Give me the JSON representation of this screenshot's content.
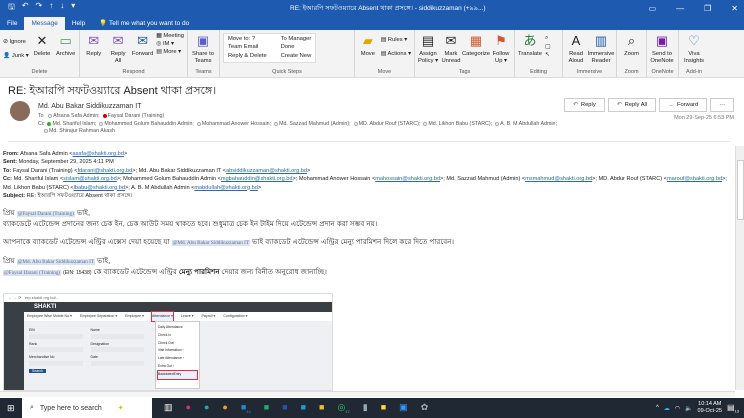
{
  "window": {
    "title": "RE: ইআরপি সফটওয়্যারে Absent থাকা প্রসঙ্গে। - siddikuzzaman (+৯৯...)",
    "qa_icons": [
      "save-icon",
      "undo-icon",
      "redo-icon",
      "up-icon",
      "down-icon",
      "customize-icon"
    ]
  },
  "tabs": [
    "File",
    "Message",
    "Help",
    "Tell me what you want to do"
  ],
  "ribbon": {
    "delete": {
      "label": "Delete",
      "ignore": "Ignore",
      "junk": "Junk ▾",
      "delete": "Delete",
      "archive": "Archive"
    },
    "respond": {
      "label": "Respond",
      "reply": "Reply",
      "reply_all": "Reply All",
      "forward": "Forward",
      "meeting": "Meeting",
      "im": "IM ▾",
      "more": "More ▾"
    },
    "teams": {
      "label": "Teams",
      "share": "Share to Teams"
    },
    "quick_steps": {
      "label": "Quick Steps",
      "items": [
        "Move to: ?",
        "To Manager",
        "Team Email",
        "Done",
        "Reply & Delete",
        "Create New"
      ]
    },
    "move": {
      "label": "Move",
      "move": "Move",
      "rules": "Rules ▾",
      "actions": "Actions ▾"
    },
    "tags": {
      "label": "Tags",
      "assign": "Assign Policy ▾",
      "unread": "Mark Unread",
      "categorize": "Categorize",
      "follow": "Follow Up ▾"
    },
    "editing": {
      "label": "Editing",
      "translate": "Translate"
    },
    "immersive": {
      "label": "Immersive",
      "read": "Read Aloud",
      "reader": "Immersive Reader"
    },
    "zoom": {
      "label": "Zoom",
      "zoom": "Zoom"
    },
    "onenote": {
      "label": "OneNote",
      "send": "Send to OneNote"
    },
    "addin": {
      "label": "Add-in",
      "viva": "Viva Insights"
    }
  },
  "message": {
    "subject": "RE: ইআরপি সফটওয়্যারে Absent থাকা প্রসঙ্গে।",
    "sender": "Md. Abu Bakar Siddikuzzaman IT",
    "to_label": "To",
    "to": [
      "Afsana Safa Admin;",
      "Faysal Darani (Training)"
    ],
    "cc_label": "Cc",
    "cc": [
      "Md. Shariful Islam;",
      "Mohammed Golum Bahauddin Admin;",
      "Mohammad Anower Hossain;",
      "Md. Sazzad Mahmud (Admin);",
      "MD. Abdur Rouf (STARC);",
      "Md. Likhon Babu (STARC);",
      "A. B. M Abdullah Admin;",
      "Md. Shirajur Rahman Akash"
    ],
    "date": "Mon 29-Sep-25 6:53 PM",
    "actions": {
      "reply": "Reply",
      "reply_all": "Reply All",
      "forward": "Forward",
      "more": "···"
    }
  },
  "quoted": {
    "from_label": "From:",
    "from": "Afsana Safa Admin <",
    "from_email": "asafa@shakti.org.bd",
    "sent_label": "Sent:",
    "sent": "Monday, September 29, 2025 4:11 PM",
    "to_label": "To:",
    "to1": "Faysal Darani (Training) <",
    "to1_email": "fdarani@shakti.org.bd",
    "to2": ">; Md. Abu Bakar Siddikuzzaman IT <",
    "to2_email": "absiddikuzzaman@shakti.org.bd",
    "cc_label": "Cc:",
    "cc": [
      {
        "n": "Md. Shariful Islam <",
        "e": "sislam@shakti.org.bd"
      },
      {
        "n": ">; Mohammed Golum Bahauddin Admin <",
        "e": "mgbahauddin@shakti.org.bd"
      },
      {
        "n": ">; Mohammad Anower Hossain <",
        "e": "mahossain@shakti.org.bd"
      },
      {
        "n": ">; Md. Sazzad Mahmud (Admin) <",
        "e": "msmahmud@shakti.org.bd"
      },
      {
        "n": ">; MD. Abdur Rouf (STARC) <",
        "e": "marouf@shakti.org.bd"
      },
      {
        "n": ">; Md. Likhon Babu (STARC) <",
        "e": "lbabu@shakti.org.bd"
      },
      {
        "n": ">; A. B. M Abdullah Admin <",
        "e": "mabdullah@shakti.org.bd"
      }
    ],
    "subject_label": "Subject:",
    "subject": "RE: ইআরপি সফটওয়্যারে Absent থাকা প্রসঙ্গে।"
  },
  "body": {
    "greet1": "প্রিয়",
    "mention1": "@Faysal Darani (Training)",
    "greet1_end": "ভাই,",
    "line1": "ব্যাকডেটে এটেন্ডেন্স প্রদানের জন্য চেক ইন, চেক আউট সময় থাকতে হবে। শুধুমাত্র চেক ইন টাইম দিয়ে এটেন্ডেন্স প্রদান করা সম্ভব নয়।",
    "line2a": "আপনাকে ব্যাকডেট এটেন্ডেন্স এন্ট্রির এক্সেস দেয়া হয়েছে যা",
    "mention2": "@Md. Abu Bakar Siddikuzzaman IT",
    "line2b": "ভাই ব্যাকডেট এটেন্ডেন্স এন্ট্রির মেন্যু পারমিশন দিলে করে দিতে পারবেন।",
    "greet2": "প্রিয়",
    "mention3": "@Md. Abu Bakar Siddikuzzaman IT",
    "greet2_end": "ভাই,",
    "mention4": "@Faysal Darani (Training)",
    "ein": "(EIN: 15438)",
    "line4a": "কে ব্যাকডেট এটেন্ডেন্স এন্ট্রির",
    "line4b": "মেন্যু পারমিশন",
    "line4c": "দেয়ার জন্য বিনীত অনুরোধ জানাচ্ছি।"
  },
  "embedded": {
    "brand": "SHAKTI",
    "menu": [
      "Employee Wise Mobile No ▾",
      "Employee Separation ▾",
      "Employee ▾",
      "Attendance ▾",
      "Leave ▾",
      "Payroll ▾",
      "Configuration ▾"
    ],
    "dropdown": [
      "Daily Attendance",
      "Check In",
      "Check Out",
      "Visit Information ›",
      "Late Attendance ›",
      "Extra Out ›",
      "BackdatedEntry"
    ],
    "fields": [
      "EIN",
      "Name",
      "Rank",
      "Designation",
      "Merchandise No",
      "Date"
    ],
    "search": "Search"
  },
  "taskbar": {
    "search_placeholder": "Type here to search",
    "time": "10:14 AM",
    "date": "09-Oct-25",
    "badges": [
      "44",
      "17",
      "13"
    ]
  }
}
